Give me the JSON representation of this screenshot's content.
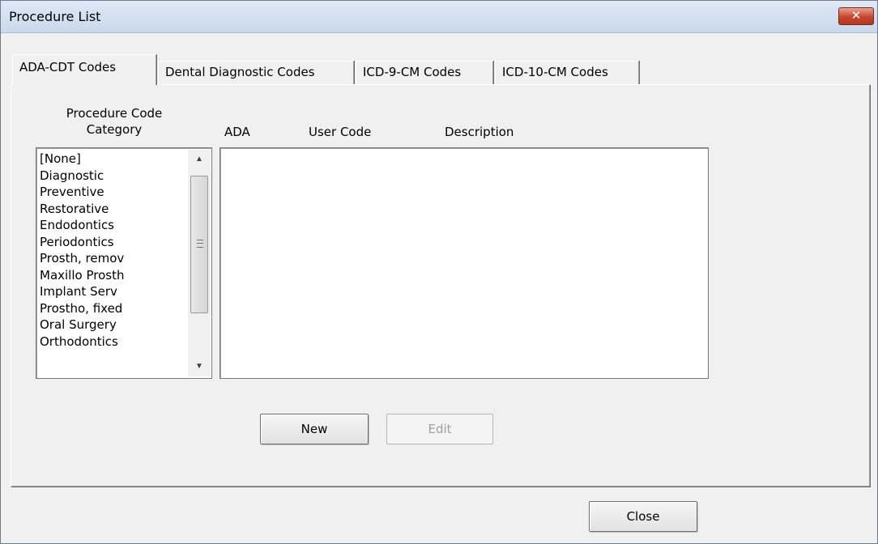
{
  "window": {
    "title": "Procedure List",
    "close_icon": "close-x-icon"
  },
  "tabs": [
    {
      "label": "ADA-CDT Codes",
      "active": true
    },
    {
      "label": "Dental Diagnostic Codes",
      "active": false
    },
    {
      "label": "ICD-9-CM Codes",
      "active": false
    },
    {
      "label": "ICD-10-CM Codes",
      "active": false
    }
  ],
  "category_panel": {
    "heading_line1": "Procedure Code",
    "heading_line2": "Category",
    "items": [
      "[None]",
      "Diagnostic",
      "Preventive",
      "Restorative",
      "Endodontics",
      "Periodontics",
      "Prosth, remov",
      "Maxillo Prosth",
      "Implant Serv",
      "Prostho, fixed",
      "Oral Surgery",
      "Orthodontics"
    ]
  },
  "grid": {
    "columns": [
      "ADA",
      "User Code",
      "Description"
    ],
    "rows": []
  },
  "buttons": {
    "new": "New",
    "edit": "Edit",
    "close": "Close"
  }
}
